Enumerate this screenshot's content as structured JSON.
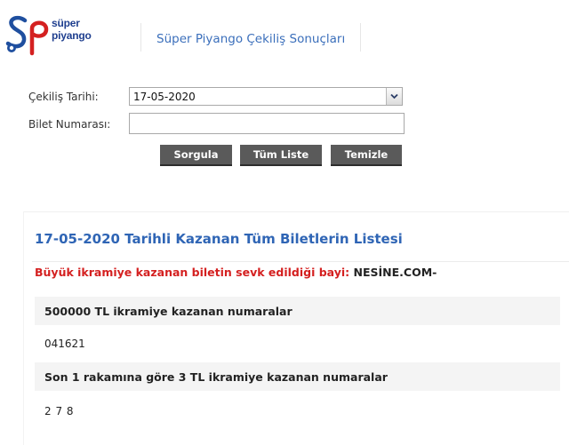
{
  "header": {
    "logo_line1": "süper",
    "logo_line2": "piyango",
    "page_title": "Süper Piyango Çekiliş Sonuçları"
  },
  "form": {
    "draw_date_label": "Çekiliş Tarihi:",
    "draw_date_value": "17-05-2020",
    "ticket_number_label": "Bilet Numarası:",
    "ticket_number_value": "",
    "buttons": {
      "query": "Sorgula",
      "full_list": "Tüm Liste",
      "clear": "Temizle"
    }
  },
  "results": {
    "title": "17-05-2020 Tarihli Kazanan Tüm Biletlerin Listesi",
    "dealer_label": "Büyük ikramiye kazanan biletin sevk edildiği bayi:",
    "dealer_value": "NESİNE.COM-",
    "sections": [
      {
        "title": "500000 TL ikramiye kazanan numaralar",
        "numbers": "041621"
      },
      {
        "title": "Son 1 rakamına göre 3 TL ikramiye kazanan numaralar",
        "numbers": "2 7 8"
      }
    ]
  },
  "colors": {
    "brand_blue": "#2f65b5",
    "brand_red": "#d42020",
    "button_gray": "#5a5a5a"
  }
}
